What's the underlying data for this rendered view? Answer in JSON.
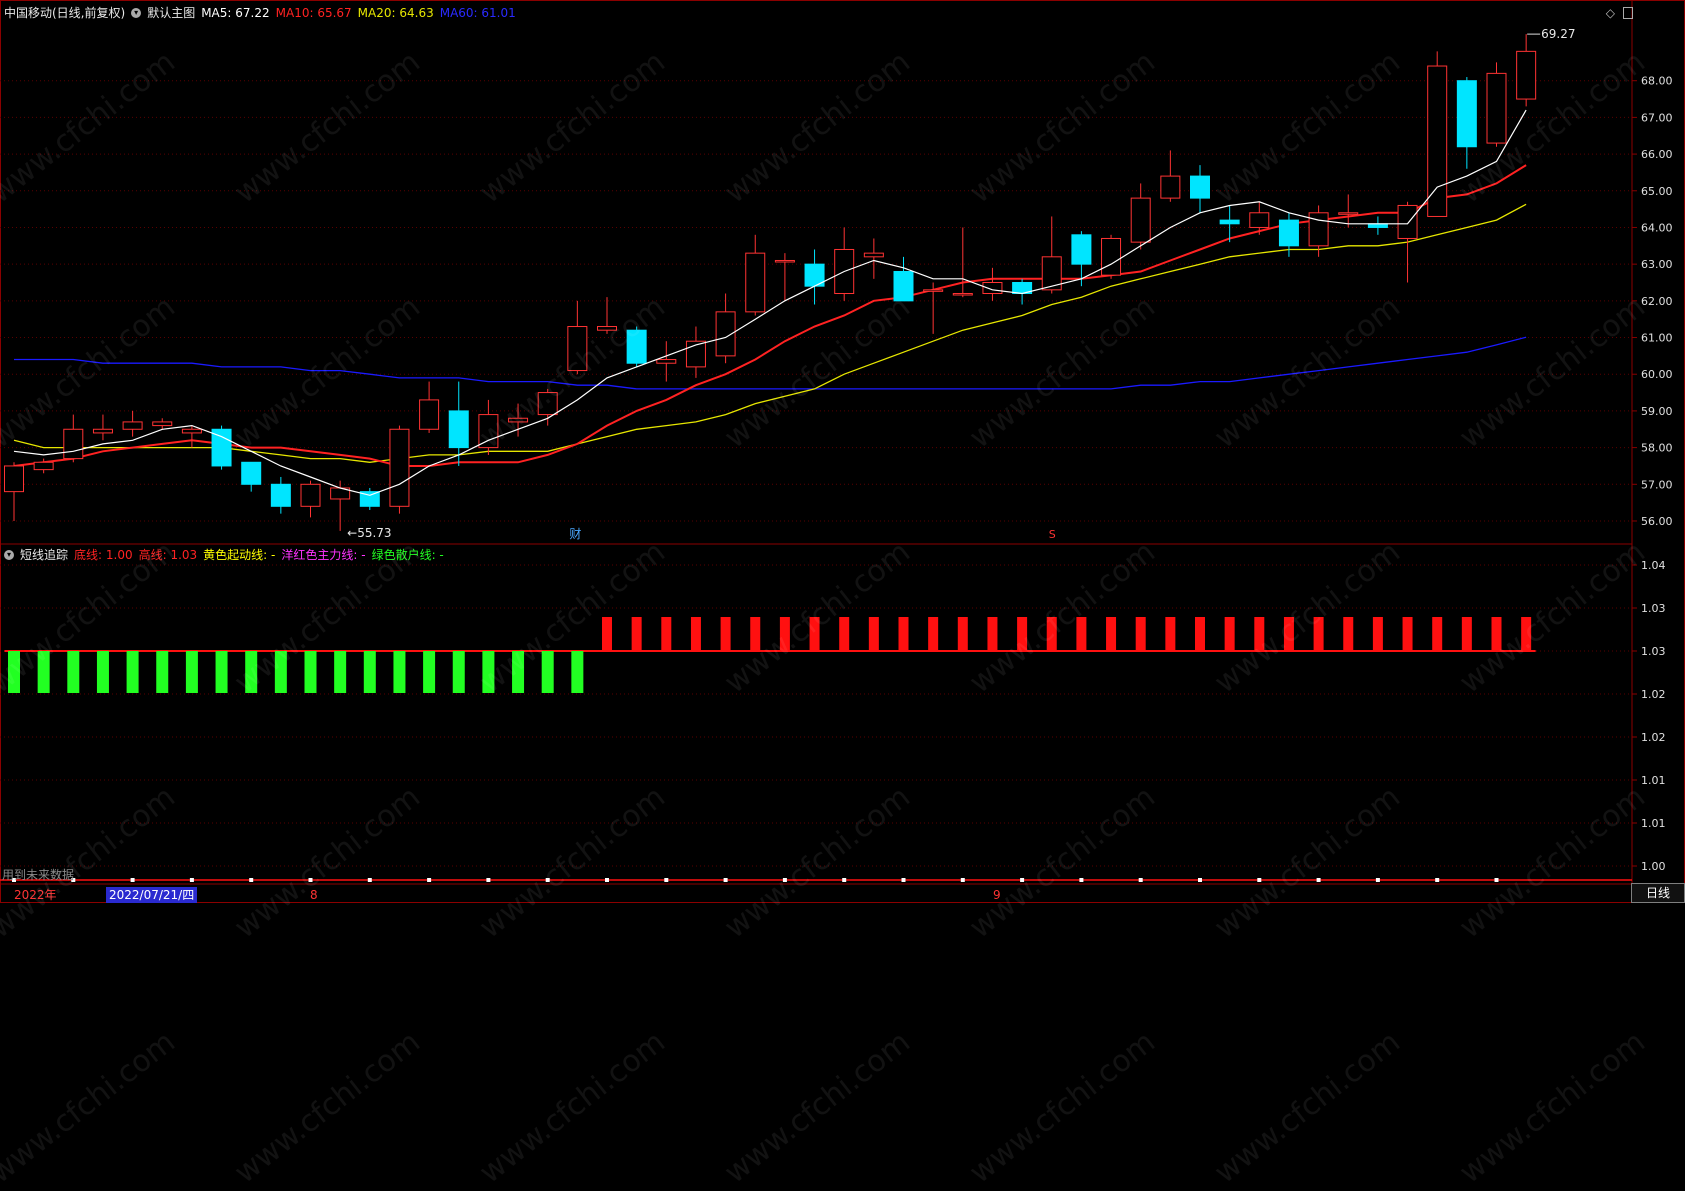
{
  "main_header": {
    "symbol": "中国移动(日线,前复权)",
    "template": "默认主图",
    "ma5": "MA5: 67.22",
    "ma10": "MA10: 65.67",
    "ma20": "MA20: 64.63",
    "ma60": "MA60: 61.01"
  },
  "sub_header": {
    "indicator": "短线追踪",
    "low_line": "底线: 1.00",
    "high_line": "高线: 1.03",
    "yellow_line": "黄色起动线: -",
    "magenta_line": "洋红色主力线: -",
    "green_line": "绿色散户线: -"
  },
  "colors": {
    "up": "#ff3333",
    "down": "#00e5ff",
    "ma5": "#ffffff",
    "ma10": "#ff2222",
    "ma20": "#e6e600",
    "ma60": "#1a1aff",
    "bar_green": "#22ff22",
    "bar_red": "#ff1010"
  },
  "annotations": {
    "high_label": "69.27",
    "low_label": "←55.73",
    "cai_marker": "财",
    "s_marker": "S",
    "future_note": "用到未来数据"
  },
  "date_axis": {
    "year": "2022年",
    "cursor_date": "2022/07/21/四",
    "month_8": "8",
    "month_9": "9"
  },
  "period_button": "日线",
  "watermark": "www.cfchi.com",
  "chart_data": [
    {
      "type": "candlestick",
      "title": "中国移动(日线,前复权)",
      "y_ticks": [
        "56.00",
        "57.00",
        "58.00",
        "59.00",
        "60.00",
        "61.00",
        "62.00",
        "63.00",
        "64.00",
        "65.00",
        "66.00",
        "67.00",
        "68.00"
      ],
      "ylim": [
        55.4,
        69.6
      ],
      "candles": [
        {
          "o": 56.8,
          "c": 57.5,
          "h": 57.6,
          "l": 56.0
        },
        {
          "o": 57.4,
          "c": 57.6,
          "h": 57.7,
          "l": 57.3
        },
        {
          "o": 57.7,
          "c": 58.5,
          "h": 58.9,
          "l": 57.6
        },
        {
          "o": 58.4,
          "c": 58.5,
          "h": 58.9,
          "l": 58.2
        },
        {
          "o": 58.5,
          "c": 58.7,
          "h": 59.0,
          "l": 58.3
        },
        {
          "o": 58.6,
          "c": 58.7,
          "h": 58.8,
          "l": 58.5
        },
        {
          "o": 58.4,
          "c": 58.5,
          "h": 58.6,
          "l": 58.0
        },
        {
          "o": 58.5,
          "c": 57.5,
          "h": 58.6,
          "l": 57.4
        },
        {
          "o": 57.6,
          "c": 57.0,
          "h": 57.6,
          "l": 56.8
        },
        {
          "o": 57.0,
          "c": 56.4,
          "h": 57.2,
          "l": 56.2
        },
        {
          "o": 56.4,
          "c": 57.0,
          "h": 57.1,
          "l": 56.1
        },
        {
          "o": 56.6,
          "c": 56.9,
          "h": 57.1,
          "l": 55.73
        },
        {
          "o": 56.8,
          "c": 56.4,
          "h": 56.9,
          "l": 56.3
        },
        {
          "o": 56.4,
          "c": 58.5,
          "h": 58.6,
          "l": 56.2
        },
        {
          "o": 58.5,
          "c": 59.3,
          "h": 59.8,
          "l": 58.4
        },
        {
          "o": 59.0,
          "c": 58.0,
          "h": 59.8,
          "l": 57.5
        },
        {
          "o": 58.0,
          "c": 58.9,
          "h": 59.3,
          "l": 57.8
        },
        {
          "o": 58.7,
          "c": 58.8,
          "h": 59.2,
          "l": 58.3
        },
        {
          "o": 58.9,
          "c": 59.5,
          "h": 59.6,
          "l": 58.6
        },
        {
          "o": 60.1,
          "c": 61.3,
          "h": 62.0,
          "l": 60.0
        },
        {
          "o": 61.2,
          "c": 61.3,
          "h": 62.1,
          "l": 61.1
        },
        {
          "o": 61.2,
          "c": 60.3,
          "h": 61.3,
          "l": 60.2
        },
        {
          "o": 60.3,
          "c": 60.4,
          "h": 60.9,
          "l": 59.8
        },
        {
          "o": 60.2,
          "c": 60.9,
          "h": 61.3,
          "l": 59.9
        },
        {
          "o": 60.5,
          "c": 61.7,
          "h": 62.2,
          "l": 60.3
        },
        {
          "o": 61.7,
          "c": 63.3,
          "h": 63.8,
          "l": 61.6
        },
        {
          "o": 63.1,
          "c": 63.1,
          "h": 63.3,
          "l": 62.0
        },
        {
          "o": 63.0,
          "c": 62.4,
          "h": 63.4,
          "l": 61.9
        },
        {
          "o": 62.2,
          "c": 63.4,
          "h": 64.0,
          "l": 62.0
        },
        {
          "o": 63.2,
          "c": 63.3,
          "h": 63.7,
          "l": 62.6
        },
        {
          "o": 62.8,
          "c": 62.0,
          "h": 63.2,
          "l": 62.0
        },
        {
          "o": 62.3,
          "c": 62.3,
          "h": 62.5,
          "l": 61.1
        },
        {
          "o": 62.2,
          "c": 62.2,
          "h": 64.0,
          "l": 62.1
        },
        {
          "o": 62.2,
          "c": 62.5,
          "h": 62.9,
          "l": 62.0
        },
        {
          "o": 62.5,
          "c": 62.2,
          "h": 62.6,
          "l": 61.9
        },
        {
          "o": 62.3,
          "c": 63.2,
          "h": 64.3,
          "l": 62.2
        },
        {
          "o": 63.8,
          "c": 63.0,
          "h": 63.9,
          "l": 62.4
        },
        {
          "o": 62.7,
          "c": 63.7,
          "h": 63.8,
          "l": 62.6
        },
        {
          "o": 63.6,
          "c": 64.8,
          "h": 65.2,
          "l": 63.4
        },
        {
          "o": 64.8,
          "c": 65.4,
          "h": 66.1,
          "l": 64.7
        },
        {
          "o": 65.4,
          "c": 64.8,
          "h": 65.7,
          "l": 64.4
        },
        {
          "o": 64.2,
          "c": 64.1,
          "h": 64.6,
          "l": 63.6
        },
        {
          "o": 64.0,
          "c": 64.4,
          "h": 64.7,
          "l": 63.8
        },
        {
          "o": 64.2,
          "c": 63.5,
          "h": 64.4,
          "l": 63.2
        },
        {
          "o": 63.5,
          "c": 64.4,
          "h": 64.6,
          "l": 63.2
        },
        {
          "o": 64.4,
          "c": 64.4,
          "h": 64.9,
          "l": 64.0
        },
        {
          "o": 64.1,
          "c": 64.0,
          "h": 64.3,
          "l": 63.8
        },
        {
          "o": 63.7,
          "c": 64.6,
          "h": 64.7,
          "l": 62.5
        },
        {
          "o": 64.3,
          "c": 68.4,
          "h": 68.8,
          "l": 64.3
        },
        {
          "o": 68.0,
          "c": 66.2,
          "h": 68.1,
          "l": 65.6
        },
        {
          "o": 66.3,
          "c": 68.2,
          "h": 68.5,
          "l": 66.2
        },
        {
          "o": 67.5,
          "c": 68.8,
          "h": 69.27,
          "l": 67.3
        }
      ],
      "ma5": [
        57.9,
        57.8,
        57.9,
        58.1,
        58.2,
        58.5,
        58.6,
        58.3,
        57.9,
        57.5,
        57.2,
        56.9,
        56.7,
        57.0,
        57.5,
        57.8,
        58.2,
        58.5,
        58.8,
        59.3,
        59.9,
        60.2,
        60.5,
        60.8,
        61.0,
        61.5,
        62.0,
        62.4,
        62.8,
        63.1,
        62.9,
        62.6,
        62.6,
        62.3,
        62.2,
        62.4,
        62.6,
        63.0,
        63.5,
        64.0,
        64.4,
        64.6,
        64.7,
        64.4,
        64.2,
        64.1,
        64.1,
        64.1,
        65.1,
        65.4,
        65.8,
        67.2
      ],
      "ma10": [
        57.5,
        57.6,
        57.7,
        57.9,
        58.0,
        58.1,
        58.2,
        58.1,
        58.0,
        58.0,
        57.9,
        57.8,
        57.7,
        57.5,
        57.5,
        57.6,
        57.6,
        57.6,
        57.8,
        58.1,
        58.6,
        59.0,
        59.3,
        59.7,
        60.0,
        60.4,
        60.9,
        61.3,
        61.6,
        62.0,
        62.1,
        62.3,
        62.5,
        62.6,
        62.6,
        62.6,
        62.6,
        62.7,
        62.8,
        63.1,
        63.4,
        63.7,
        63.9,
        64.1,
        64.2,
        64.3,
        64.4,
        64.4,
        64.8,
        64.9,
        65.2,
        65.7
      ],
      "ma20": [
        58.2,
        58.0,
        58.0,
        58.0,
        58.0,
        58.0,
        58.0,
        58.0,
        57.9,
        57.8,
        57.7,
        57.7,
        57.6,
        57.7,
        57.8,
        57.8,
        57.9,
        57.9,
        57.9,
        58.1,
        58.3,
        58.5,
        58.6,
        58.7,
        58.9,
        59.2,
        59.4,
        59.6,
        60.0,
        60.3,
        60.6,
        60.9,
        61.2,
        61.4,
        61.6,
        61.9,
        62.1,
        62.4,
        62.6,
        62.8,
        63.0,
        63.2,
        63.3,
        63.4,
        63.4,
        63.5,
        63.5,
        63.6,
        63.8,
        64.0,
        64.2,
        64.63
      ],
      "ma60": [
        60.4,
        60.4,
        60.4,
        60.3,
        60.3,
        60.3,
        60.3,
        60.2,
        60.2,
        60.2,
        60.1,
        60.1,
        60.0,
        59.9,
        59.9,
        59.9,
        59.8,
        59.8,
        59.8,
        59.7,
        59.7,
        59.6,
        59.6,
        59.6,
        59.6,
        59.6,
        59.6,
        59.6,
        59.6,
        59.6,
        59.6,
        59.6,
        59.6,
        59.6,
        59.6,
        59.6,
        59.6,
        59.6,
        59.7,
        59.7,
        59.8,
        59.8,
        59.9,
        60.0,
        60.1,
        60.2,
        60.3,
        60.4,
        60.5,
        60.6,
        60.8,
        61.01
      ]
    },
    {
      "type": "bar",
      "title": "短线追踪",
      "y_ticks": [
        "1.00",
        "1.01",
        "1.01",
        "1.02",
        "1.02",
        "1.03",
        "1.03",
        "1.04"
      ],
      "ylim": [
        0.995,
        1.04
      ],
      "baseline": 1.03,
      "green_bars": {
        "count": 20,
        "low": 1.02,
        "high": 1.03
      },
      "red_bars": {
        "count": 32,
        "low": 1.03,
        "high": 1.035
      }
    }
  ]
}
